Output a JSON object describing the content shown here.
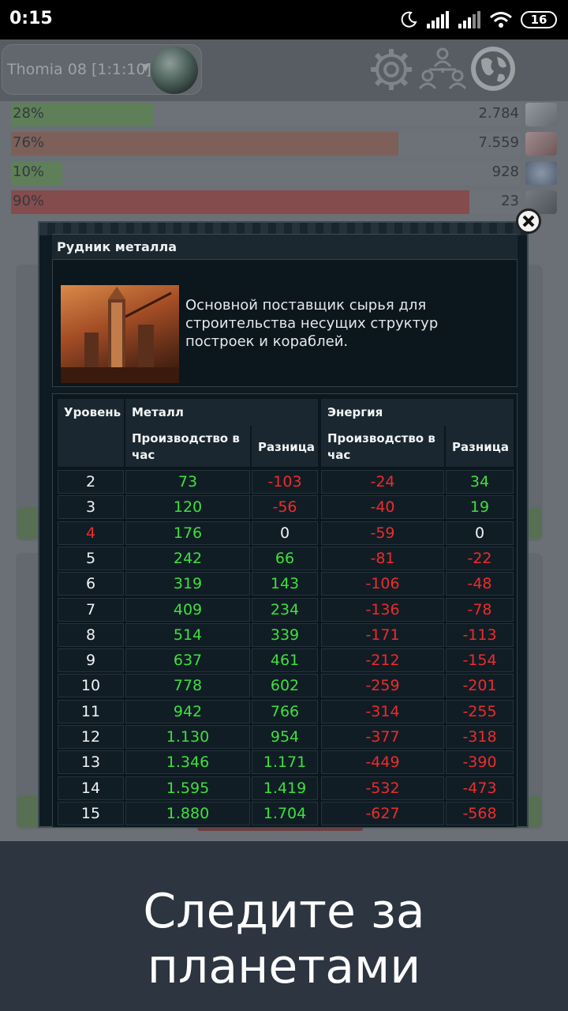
{
  "status_bar": {
    "time": "0:15",
    "battery": "16"
  },
  "header": {
    "planet_name": "Thomia 08 [1:1:10]"
  },
  "resources": [
    {
      "percent": "28%",
      "amount": "2.784",
      "fill_fraction": 0.28,
      "color": "#79a56a"
    },
    {
      "percent": "76%",
      "amount": "7.559",
      "fill_fraction": 0.76,
      "color": "#a5786c"
    },
    {
      "percent": "10%",
      "amount": "928",
      "fill_fraction": 0.1,
      "color": "#79a56a"
    },
    {
      "percent": "90%",
      "amount": "23",
      "fill_fraction": 0.9,
      "color": "#b15a5a"
    }
  ],
  "modal": {
    "title": "Рудник металла",
    "description": "Основной поставщик сырья для строительства несущих структур построек и кораблей.",
    "table": {
      "headers": {
        "level": "Уровень",
        "metal": "Металл",
        "energy": "Энергия",
        "metal_production": "Производство в час",
        "metal_diff": "Разница",
        "energy_production": "Производство в час",
        "energy_diff": "Разница"
      },
      "rows": [
        {
          "level": "2",
          "metal_prod": "73",
          "metal_diff": "-103",
          "energy_prod": "-24",
          "energy_diff": "34"
        },
        {
          "level": "3",
          "metal_prod": "120",
          "metal_diff": "-56",
          "energy_prod": "-40",
          "energy_diff": "19"
        },
        {
          "level": "4",
          "metal_prod": "176",
          "metal_diff": "0",
          "energy_prod": "-59",
          "energy_diff": "0",
          "current": true
        },
        {
          "level": "5",
          "metal_prod": "242",
          "metal_diff": "66",
          "energy_prod": "-81",
          "energy_diff": "-22"
        },
        {
          "level": "6",
          "metal_prod": "319",
          "metal_diff": "143",
          "energy_prod": "-106",
          "energy_diff": "-48"
        },
        {
          "level": "7",
          "metal_prod": "409",
          "metal_diff": "234",
          "energy_prod": "-136",
          "energy_diff": "-78"
        },
        {
          "level": "8",
          "metal_prod": "514",
          "metal_diff": "339",
          "energy_prod": "-171",
          "energy_diff": "-113"
        },
        {
          "level": "9",
          "metal_prod": "637",
          "metal_diff": "461",
          "energy_prod": "-212",
          "energy_diff": "-154"
        },
        {
          "level": "10",
          "metal_prod": "778",
          "metal_diff": "602",
          "energy_prod": "-259",
          "energy_diff": "-201"
        },
        {
          "level": "11",
          "metal_prod": "942",
          "metal_diff": "766",
          "energy_prod": "-314",
          "energy_diff": "-255"
        },
        {
          "level": "12",
          "metal_prod": "1.130",
          "metal_diff": "954",
          "energy_prod": "-377",
          "energy_diff": "-318"
        },
        {
          "level": "13",
          "metal_prod": "1.346",
          "metal_diff": "1.171",
          "energy_prod": "-449",
          "energy_diff": "-390"
        },
        {
          "level": "14",
          "metal_prod": "1.595",
          "metal_diff": "1.419",
          "energy_prod": "-532",
          "energy_diff": "-473"
        },
        {
          "level": "15",
          "metal_prod": "1.880",
          "metal_diff": "1.704",
          "energy_prod": "-627",
          "energy_diff": "-568"
        }
      ]
    }
  },
  "caption": "Следите за планетами",
  "colors": {
    "positive": "#3de03d",
    "negative": "#ee2b2b",
    "neutral": "#f0f2f4"
  },
  "icons": [
    "moon-icon",
    "signal-icon",
    "wifi-icon",
    "gear-icon",
    "alliance-icon",
    "globe-icon",
    "close-icon",
    "metal-resource-icon",
    "crystal-resource-icon",
    "deuterium-resource-icon",
    "energy-resource-icon"
  ]
}
